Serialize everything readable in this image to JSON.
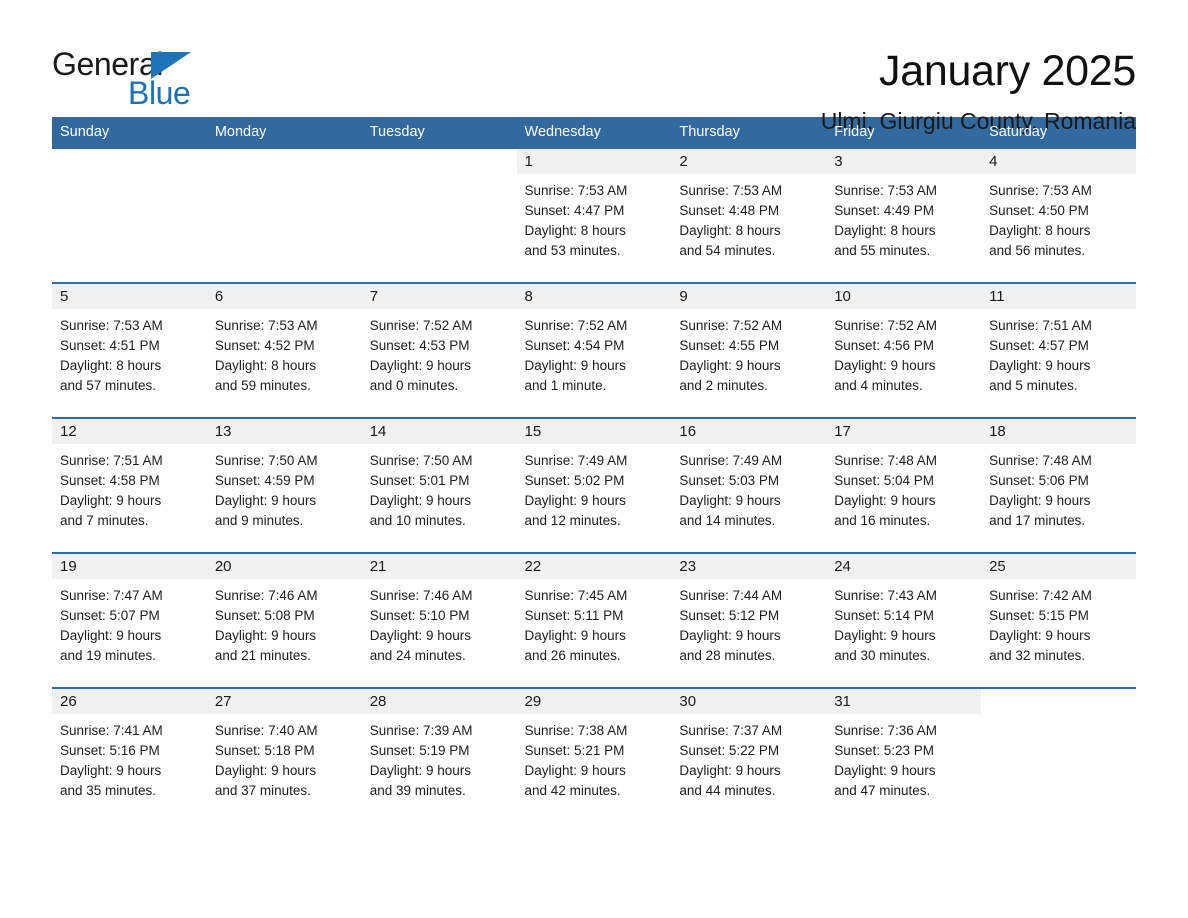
{
  "brand": {
    "name_part1": "General",
    "name_part2": "Blue",
    "accent_color": "#1a72b8",
    "triangle_color": "#1f73b8"
  },
  "header": {
    "month_title": "January 2025",
    "location": "Ulmi, Giurgiu County, Romania"
  },
  "calendar": {
    "header_bg": "#32699f",
    "row_divider_color": "#2f6da9",
    "daynum_band_bg": "#f1f1f1",
    "weekday_headers": [
      "Sunday",
      "Monday",
      "Tuesday",
      "Wednesday",
      "Thursday",
      "Friday",
      "Saturday"
    ],
    "weeks": [
      [
        {
          "day": "",
          "sunrise": "",
          "sunset": "",
          "daylight_line1": "",
          "daylight_line2": "",
          "blank": true
        },
        {
          "day": "",
          "sunrise": "",
          "sunset": "",
          "daylight_line1": "",
          "daylight_line2": "",
          "blank": true
        },
        {
          "day": "",
          "sunrise": "",
          "sunset": "",
          "daylight_line1": "",
          "daylight_line2": "",
          "blank": true
        },
        {
          "day": "1",
          "sunrise": "Sunrise: 7:53 AM",
          "sunset": "Sunset: 4:47 PM",
          "daylight_line1": "Daylight: 8 hours",
          "daylight_line2": "and 53 minutes."
        },
        {
          "day": "2",
          "sunrise": "Sunrise: 7:53 AM",
          "sunset": "Sunset: 4:48 PM",
          "daylight_line1": "Daylight: 8 hours",
          "daylight_line2": "and 54 minutes."
        },
        {
          "day": "3",
          "sunrise": "Sunrise: 7:53 AM",
          "sunset": "Sunset: 4:49 PM",
          "daylight_line1": "Daylight: 8 hours",
          "daylight_line2": "and 55 minutes."
        },
        {
          "day": "4",
          "sunrise": "Sunrise: 7:53 AM",
          "sunset": "Sunset: 4:50 PM",
          "daylight_line1": "Daylight: 8 hours",
          "daylight_line2": "and 56 minutes."
        }
      ],
      [
        {
          "day": "5",
          "sunrise": "Sunrise: 7:53 AM",
          "sunset": "Sunset: 4:51 PM",
          "daylight_line1": "Daylight: 8 hours",
          "daylight_line2": "and 57 minutes."
        },
        {
          "day": "6",
          "sunrise": "Sunrise: 7:53 AM",
          "sunset": "Sunset: 4:52 PM",
          "daylight_line1": "Daylight: 8 hours",
          "daylight_line2": "and 59 minutes."
        },
        {
          "day": "7",
          "sunrise": "Sunrise: 7:52 AM",
          "sunset": "Sunset: 4:53 PM",
          "daylight_line1": "Daylight: 9 hours",
          "daylight_line2": "and 0 minutes."
        },
        {
          "day": "8",
          "sunrise": "Sunrise: 7:52 AM",
          "sunset": "Sunset: 4:54 PM",
          "daylight_line1": "Daylight: 9 hours",
          "daylight_line2": "and 1 minute."
        },
        {
          "day": "9",
          "sunrise": "Sunrise: 7:52 AM",
          "sunset": "Sunset: 4:55 PM",
          "daylight_line1": "Daylight: 9 hours",
          "daylight_line2": "and 2 minutes."
        },
        {
          "day": "10",
          "sunrise": "Sunrise: 7:52 AM",
          "sunset": "Sunset: 4:56 PM",
          "daylight_line1": "Daylight: 9 hours",
          "daylight_line2": "and 4 minutes."
        },
        {
          "day": "11",
          "sunrise": "Sunrise: 7:51 AM",
          "sunset": "Sunset: 4:57 PM",
          "daylight_line1": "Daylight: 9 hours",
          "daylight_line2": "and 5 minutes."
        }
      ],
      [
        {
          "day": "12",
          "sunrise": "Sunrise: 7:51 AM",
          "sunset": "Sunset: 4:58 PM",
          "daylight_line1": "Daylight: 9 hours",
          "daylight_line2": "and 7 minutes."
        },
        {
          "day": "13",
          "sunrise": "Sunrise: 7:50 AM",
          "sunset": "Sunset: 4:59 PM",
          "daylight_line1": "Daylight: 9 hours",
          "daylight_line2": "and 9 minutes."
        },
        {
          "day": "14",
          "sunrise": "Sunrise: 7:50 AM",
          "sunset": "Sunset: 5:01 PM",
          "daylight_line1": "Daylight: 9 hours",
          "daylight_line2": "and 10 minutes."
        },
        {
          "day": "15",
          "sunrise": "Sunrise: 7:49 AM",
          "sunset": "Sunset: 5:02 PM",
          "daylight_line1": "Daylight: 9 hours",
          "daylight_line2": "and 12 minutes."
        },
        {
          "day": "16",
          "sunrise": "Sunrise: 7:49 AM",
          "sunset": "Sunset: 5:03 PM",
          "daylight_line1": "Daylight: 9 hours",
          "daylight_line2": "and 14 minutes."
        },
        {
          "day": "17",
          "sunrise": "Sunrise: 7:48 AM",
          "sunset": "Sunset: 5:04 PM",
          "daylight_line1": "Daylight: 9 hours",
          "daylight_line2": "and 16 minutes."
        },
        {
          "day": "18",
          "sunrise": "Sunrise: 7:48 AM",
          "sunset": "Sunset: 5:06 PM",
          "daylight_line1": "Daylight: 9 hours",
          "daylight_line2": "and 17 minutes."
        }
      ],
      [
        {
          "day": "19",
          "sunrise": "Sunrise: 7:47 AM",
          "sunset": "Sunset: 5:07 PM",
          "daylight_line1": "Daylight: 9 hours",
          "daylight_line2": "and 19 minutes."
        },
        {
          "day": "20",
          "sunrise": "Sunrise: 7:46 AM",
          "sunset": "Sunset: 5:08 PM",
          "daylight_line1": "Daylight: 9 hours",
          "daylight_line2": "and 21 minutes."
        },
        {
          "day": "21",
          "sunrise": "Sunrise: 7:46 AM",
          "sunset": "Sunset: 5:10 PM",
          "daylight_line1": "Daylight: 9 hours",
          "daylight_line2": "and 24 minutes."
        },
        {
          "day": "22",
          "sunrise": "Sunrise: 7:45 AM",
          "sunset": "Sunset: 5:11 PM",
          "daylight_line1": "Daylight: 9 hours",
          "daylight_line2": "and 26 minutes."
        },
        {
          "day": "23",
          "sunrise": "Sunrise: 7:44 AM",
          "sunset": "Sunset: 5:12 PM",
          "daylight_line1": "Daylight: 9 hours",
          "daylight_line2": "and 28 minutes."
        },
        {
          "day": "24",
          "sunrise": "Sunrise: 7:43 AM",
          "sunset": "Sunset: 5:14 PM",
          "daylight_line1": "Daylight: 9 hours",
          "daylight_line2": "and 30 minutes."
        },
        {
          "day": "25",
          "sunrise": "Sunrise: 7:42 AM",
          "sunset": "Sunset: 5:15 PM",
          "daylight_line1": "Daylight: 9 hours",
          "daylight_line2": "and 32 minutes."
        }
      ],
      [
        {
          "day": "26",
          "sunrise": "Sunrise: 7:41 AM",
          "sunset": "Sunset: 5:16 PM",
          "daylight_line1": "Daylight: 9 hours",
          "daylight_line2": "and 35 minutes."
        },
        {
          "day": "27",
          "sunrise": "Sunrise: 7:40 AM",
          "sunset": "Sunset: 5:18 PM",
          "daylight_line1": "Daylight: 9 hours",
          "daylight_line2": "and 37 minutes."
        },
        {
          "day": "28",
          "sunrise": "Sunrise: 7:39 AM",
          "sunset": "Sunset: 5:19 PM",
          "daylight_line1": "Daylight: 9 hours",
          "daylight_line2": "and 39 minutes."
        },
        {
          "day": "29",
          "sunrise": "Sunrise: 7:38 AM",
          "sunset": "Sunset: 5:21 PM",
          "daylight_line1": "Daylight: 9 hours",
          "daylight_line2": "and 42 minutes."
        },
        {
          "day": "30",
          "sunrise": "Sunrise: 7:37 AM",
          "sunset": "Sunset: 5:22 PM",
          "daylight_line1": "Daylight: 9 hours",
          "daylight_line2": "and 44 minutes."
        },
        {
          "day": "31",
          "sunrise": "Sunrise: 7:36 AM",
          "sunset": "Sunset: 5:23 PM",
          "daylight_line1": "Daylight: 9 hours",
          "daylight_line2": "and 47 minutes."
        },
        {
          "day": "",
          "sunrise": "",
          "sunset": "",
          "daylight_line1": "",
          "daylight_line2": "",
          "blank": true
        }
      ]
    ]
  }
}
